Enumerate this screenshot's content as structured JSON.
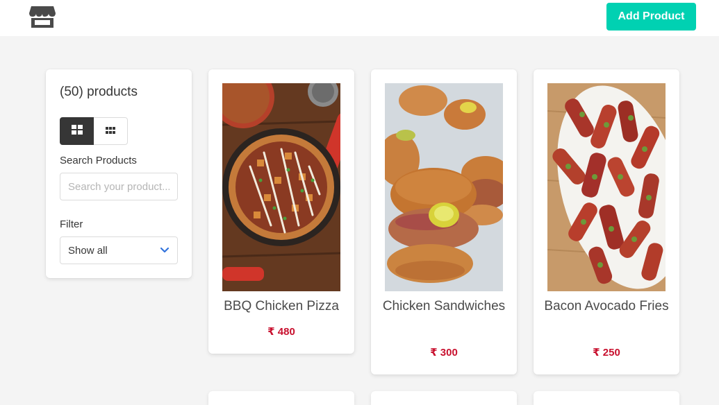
{
  "navbar": {
    "logo_icon": "store-icon",
    "add_product_label": "Add Product",
    "accent_color": "#00d1b2"
  },
  "sidebar": {
    "product_count": "(50) products",
    "view_options": [
      {
        "icon": "grid-large-icon",
        "active": true
      },
      {
        "icon": "grid-small-icon",
        "active": false
      }
    ],
    "search_label": "Search Products",
    "search_placeholder": "Search your product...",
    "search_value": "",
    "filter_label": "Filter",
    "filter_selected": "Show all",
    "filter_icon": "chevron-down-icon"
  },
  "products": [
    {
      "name": "BBQ Chicken Pizza",
      "price": "₹ 480",
      "image": "pizza"
    },
    {
      "name": "Chicken Sandwiches",
      "price": "₹ 300",
      "image": "sandwich"
    },
    {
      "name": "Bacon Avocado Fries",
      "price": "₹ 250",
      "image": "fries"
    }
  ],
  "price_color": "#c8102e"
}
